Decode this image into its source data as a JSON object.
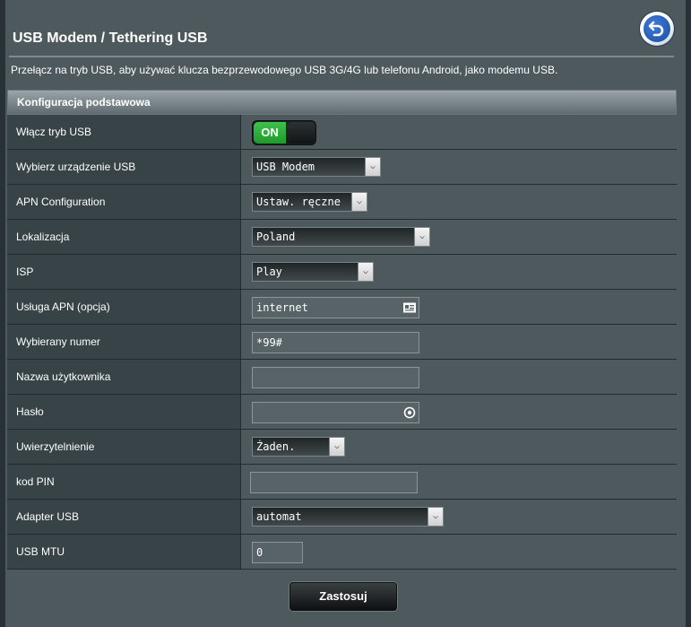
{
  "page": {
    "title": "USB Modem / Tethering USB",
    "description": "Przełącz na tryb USB, aby używać klucza bezprzewodowego USB 3G/4G lub telefonu Android, jako modemu USB."
  },
  "section": {
    "header": "Konfiguracja podstawowa"
  },
  "rows": {
    "usb_mode": {
      "label": "Włącz tryb USB",
      "toggle": "ON"
    },
    "device": {
      "label": "Wybierz urządzenie USB",
      "value": "USB Modem"
    },
    "apn_config": {
      "label": "APN Configuration",
      "value": "Ustaw. ręczne"
    },
    "location": {
      "label": "Lokalizacja",
      "value": "Poland"
    },
    "isp": {
      "label": "ISP",
      "value": "Play"
    },
    "apn_service": {
      "label": "Usługa APN (opcja)",
      "value": "internet"
    },
    "dial_number": {
      "label": "Wybierany numer",
      "value": "*99#"
    },
    "username": {
      "label": "Nazwa użytkownika",
      "value": ""
    },
    "password": {
      "label": "Hasło",
      "value": ""
    },
    "auth": {
      "label": "Uwierzytelnienie",
      "value": "Żaden."
    },
    "pin": {
      "label": "kod PIN",
      "value": ""
    },
    "adapter": {
      "label": "Adapter USB",
      "value": "automat"
    },
    "mtu": {
      "label": "USB MTU",
      "value": "0"
    }
  },
  "buttons": {
    "apply": "Zastosuj"
  },
  "colors": {
    "accent_green": "#2db33a",
    "background": "#4d595d",
    "label_bg": "#374347"
  }
}
